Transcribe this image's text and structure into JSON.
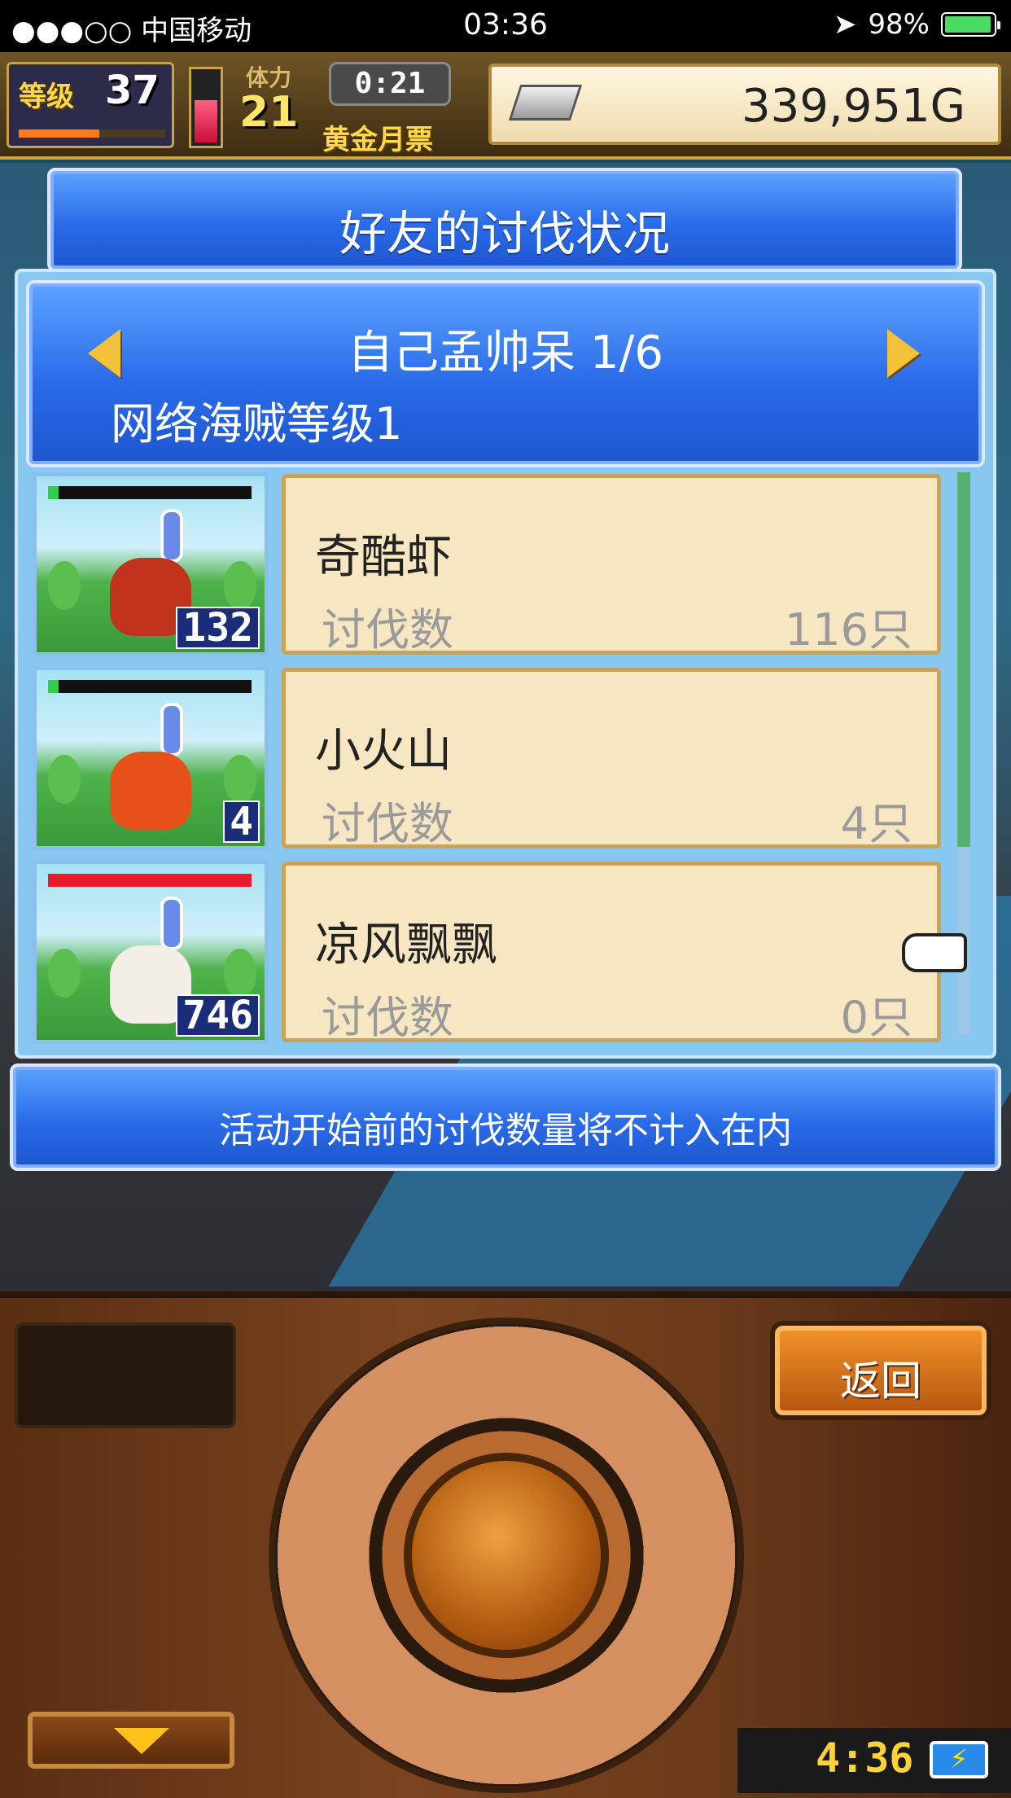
{
  "status_bar": {
    "carrier": "●●●○○ 中国移动",
    "time": "03:36",
    "battery": "98%"
  },
  "hud": {
    "level_label": "等级",
    "level": "37",
    "exp_fraction": 0.55,
    "stamina_label": "体力",
    "stamina": "21",
    "stamina_fraction": 0.6,
    "timer": "0:21",
    "gold_ticket": "黄金月票",
    "money": "339,951G"
  },
  "title": "好友的讨伐状况",
  "friend": {
    "name_page": "自己孟帅呆 1/6",
    "subtitle": "网络海贼等级1"
  },
  "monsters": [
    {
      "name": "奇酷虾",
      "label": "讨伐数",
      "kills": "116只",
      "badge": "132",
      "hp_fraction": 0.05,
      "hp_color": "#2ed04a",
      "monster_color": "#c0341e"
    },
    {
      "name": "小火山",
      "label": "讨伐数",
      "kills": "4只",
      "badge": "4",
      "hp_fraction": 0.05,
      "hp_color": "#2ed04a",
      "monster_color": "#e8501a"
    },
    {
      "name": "凉风飘飘",
      "label": "讨伐数",
      "kills": "0只",
      "badge": "746",
      "hp_fraction": 1.0,
      "hp_color": "#e81a2a",
      "monster_color": "#f4efe6"
    }
  ],
  "notice": "活动开始前的讨伐数量将不计入在内",
  "controller": {
    "back_label": "返回",
    "clock": "4:36"
  },
  "colors": {
    "panel_blue": "#2a6be8",
    "card_bg": "#f6e6c2",
    "gold": "#d8b44a"
  }
}
